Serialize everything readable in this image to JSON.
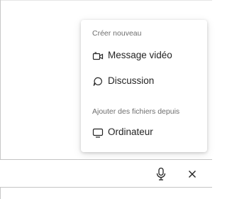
{
  "menu": {
    "create_heading": "Créer nouveau",
    "create_items": [
      {
        "label": "Message vidéo",
        "icon": "video-message-icon"
      },
      {
        "label": "Discussion",
        "icon": "discussion-icon"
      }
    ],
    "attach_heading": "Ajouter des fichiers depuis",
    "attach_items": [
      {
        "label": "Ordinateur",
        "icon": "computer-icon"
      }
    ]
  },
  "composer": {
    "icons": [
      "microphone-icon",
      "close-icon"
    ]
  },
  "colors": {
    "text": "#242424",
    "muted": "#6e6e6e",
    "border": "#c4c4c4"
  }
}
